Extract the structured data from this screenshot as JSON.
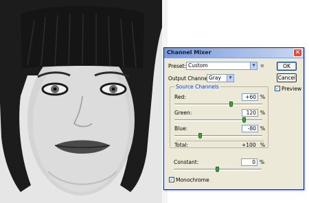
{
  "dialog": {
    "title": "Channel Mixer",
    "close_icon": "close-icon",
    "preset_label": "Preset:",
    "preset_value": "Custom",
    "output_label": "Output Channel:",
    "output_value": "Gray",
    "ok_label": "OK",
    "cancel_label": "Cancel",
    "preview_label": "Preview",
    "preview_checked": true,
    "source_channels_title": "Source Channels",
    "channels": [
      {
        "label": "Red:",
        "value": "+60",
        "unit": "%",
        "slider_fraction": 0.65
      },
      {
        "label": "Green:",
        "value": "120",
        "unit": "%",
        "slider_fraction": 0.8
      },
      {
        "label": "Blue:",
        "value": "-80",
        "unit": "%",
        "slider_fraction": 0.3
      }
    ],
    "total_label": "Total:",
    "total_value": "+100",
    "total_unit": "%",
    "constant_label": "Constant:",
    "constant_value": "0",
    "constant_unit": "%",
    "constant_slider_fraction": 0.5,
    "monochrome_label": "Monochrome",
    "monochrome_checked": true
  },
  "colors": {
    "titlebar_start": "#7a9ad6",
    "close_button": "#d8523c",
    "slider_thumb": "#3ea83e",
    "group_title": "#0046d5"
  }
}
